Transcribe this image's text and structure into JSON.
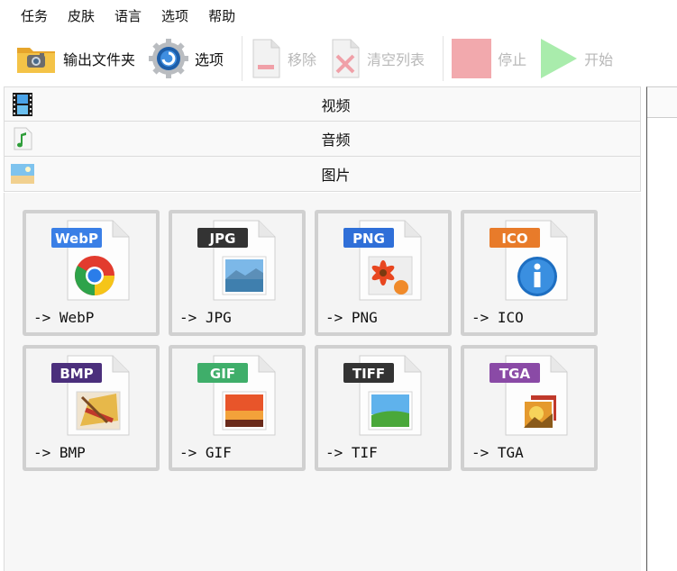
{
  "menu": [
    "任务",
    "皮肤",
    "语言",
    "选项",
    "帮助"
  ],
  "toolbar": {
    "output_folder": "输出文件夹",
    "options": "选项",
    "remove": "移除",
    "clear_list": "清空列表",
    "stop": "停止",
    "start": "开始"
  },
  "categories": [
    "视频",
    "音频",
    "图片"
  ],
  "formats": [
    {
      "badge": "WebP",
      "label": "-> WebP",
      "color": "#3a7fe6"
    },
    {
      "badge": "JPG",
      "label": "-> JPG",
      "color": "#333333"
    },
    {
      "badge": "PNG",
      "label": "-> PNG",
      "color": "#2f6fd8"
    },
    {
      "badge": "ICO",
      "label": "-> ICO",
      "color": "#e87b2a"
    },
    {
      "badge": "BMP",
      "label": "-> BMP",
      "color": "#4b2f7c"
    },
    {
      "badge": "GIF",
      "label": "-> GIF",
      "color": "#3fae6a"
    },
    {
      "badge": "TIFF",
      "label": "-> TIF",
      "color": "#333333"
    },
    {
      "badge": "TGA",
      "label": "-> TGA",
      "color": "#8a4aa6"
    }
  ]
}
